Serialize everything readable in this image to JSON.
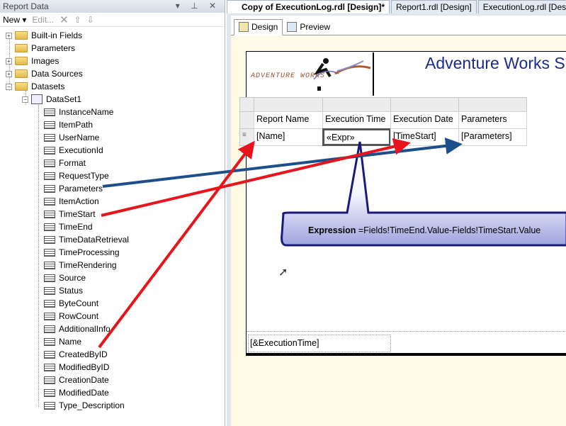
{
  "panel": {
    "title": "Report Data",
    "controls": "▾ ⊥ ✕",
    "toolbar": {
      "new": "New ▾",
      "edit": "Edit...",
      "delete": "✕",
      "up": "⇧",
      "down": "⇩"
    }
  },
  "tree": {
    "folders": [
      {
        "label": "Built-in Fields",
        "exp": "+"
      },
      {
        "label": "Parameters",
        "exp": ""
      },
      {
        "label": "Images",
        "exp": "+"
      },
      {
        "label": "Data Sources",
        "exp": "+"
      },
      {
        "label": "Datasets",
        "exp": "−"
      }
    ],
    "dataset": "DataSet1",
    "fields": [
      "InstanceName",
      "ItemPath",
      "UserName",
      "ExecutionId",
      "Format",
      "RequestType",
      "Parameters",
      "ItemAction",
      "TimeStart",
      "TimeEnd",
      "TimeDataRetrieval",
      "TimeProcessing",
      "TimeRendering",
      "Source",
      "Status",
      "ByteCount",
      "RowCount",
      "AdditionalInfo",
      "Name",
      "CreatedByID",
      "ModifiedByID",
      "CreationDate",
      "ModifiedDate",
      "Type_Description"
    ]
  },
  "doc_tabs": [
    "Copy of ExecutionLog.rdl [Design]*",
    "Report1.rdl [Design]",
    "ExecutionLog.rdl [Design]"
  ],
  "view_tabs": [
    "Design",
    "Preview"
  ],
  "report": {
    "logo": "ADVENTURE WORKS",
    "title": "Adventure Works S",
    "headers": [
      "Report Name",
      "Execution Time",
      "Execution Date",
      "Parameters"
    ],
    "row": [
      "[Name]",
      "«Expr»",
      "[TimeStart]",
      "[Parameters]"
    ],
    "row_handle": "≡",
    "footer": "[&ExecutionTime]"
  },
  "callout": {
    "label": "Expression",
    "expr": " =Fields!TimeEnd.Value-Fields!TimeStart.Value"
  },
  "colors": {
    "arrow_red": "#e8141c",
    "arrow_blue": "#1d4f8a",
    "title": "#1b2b8f",
    "canvas": "#fffbe6"
  }
}
